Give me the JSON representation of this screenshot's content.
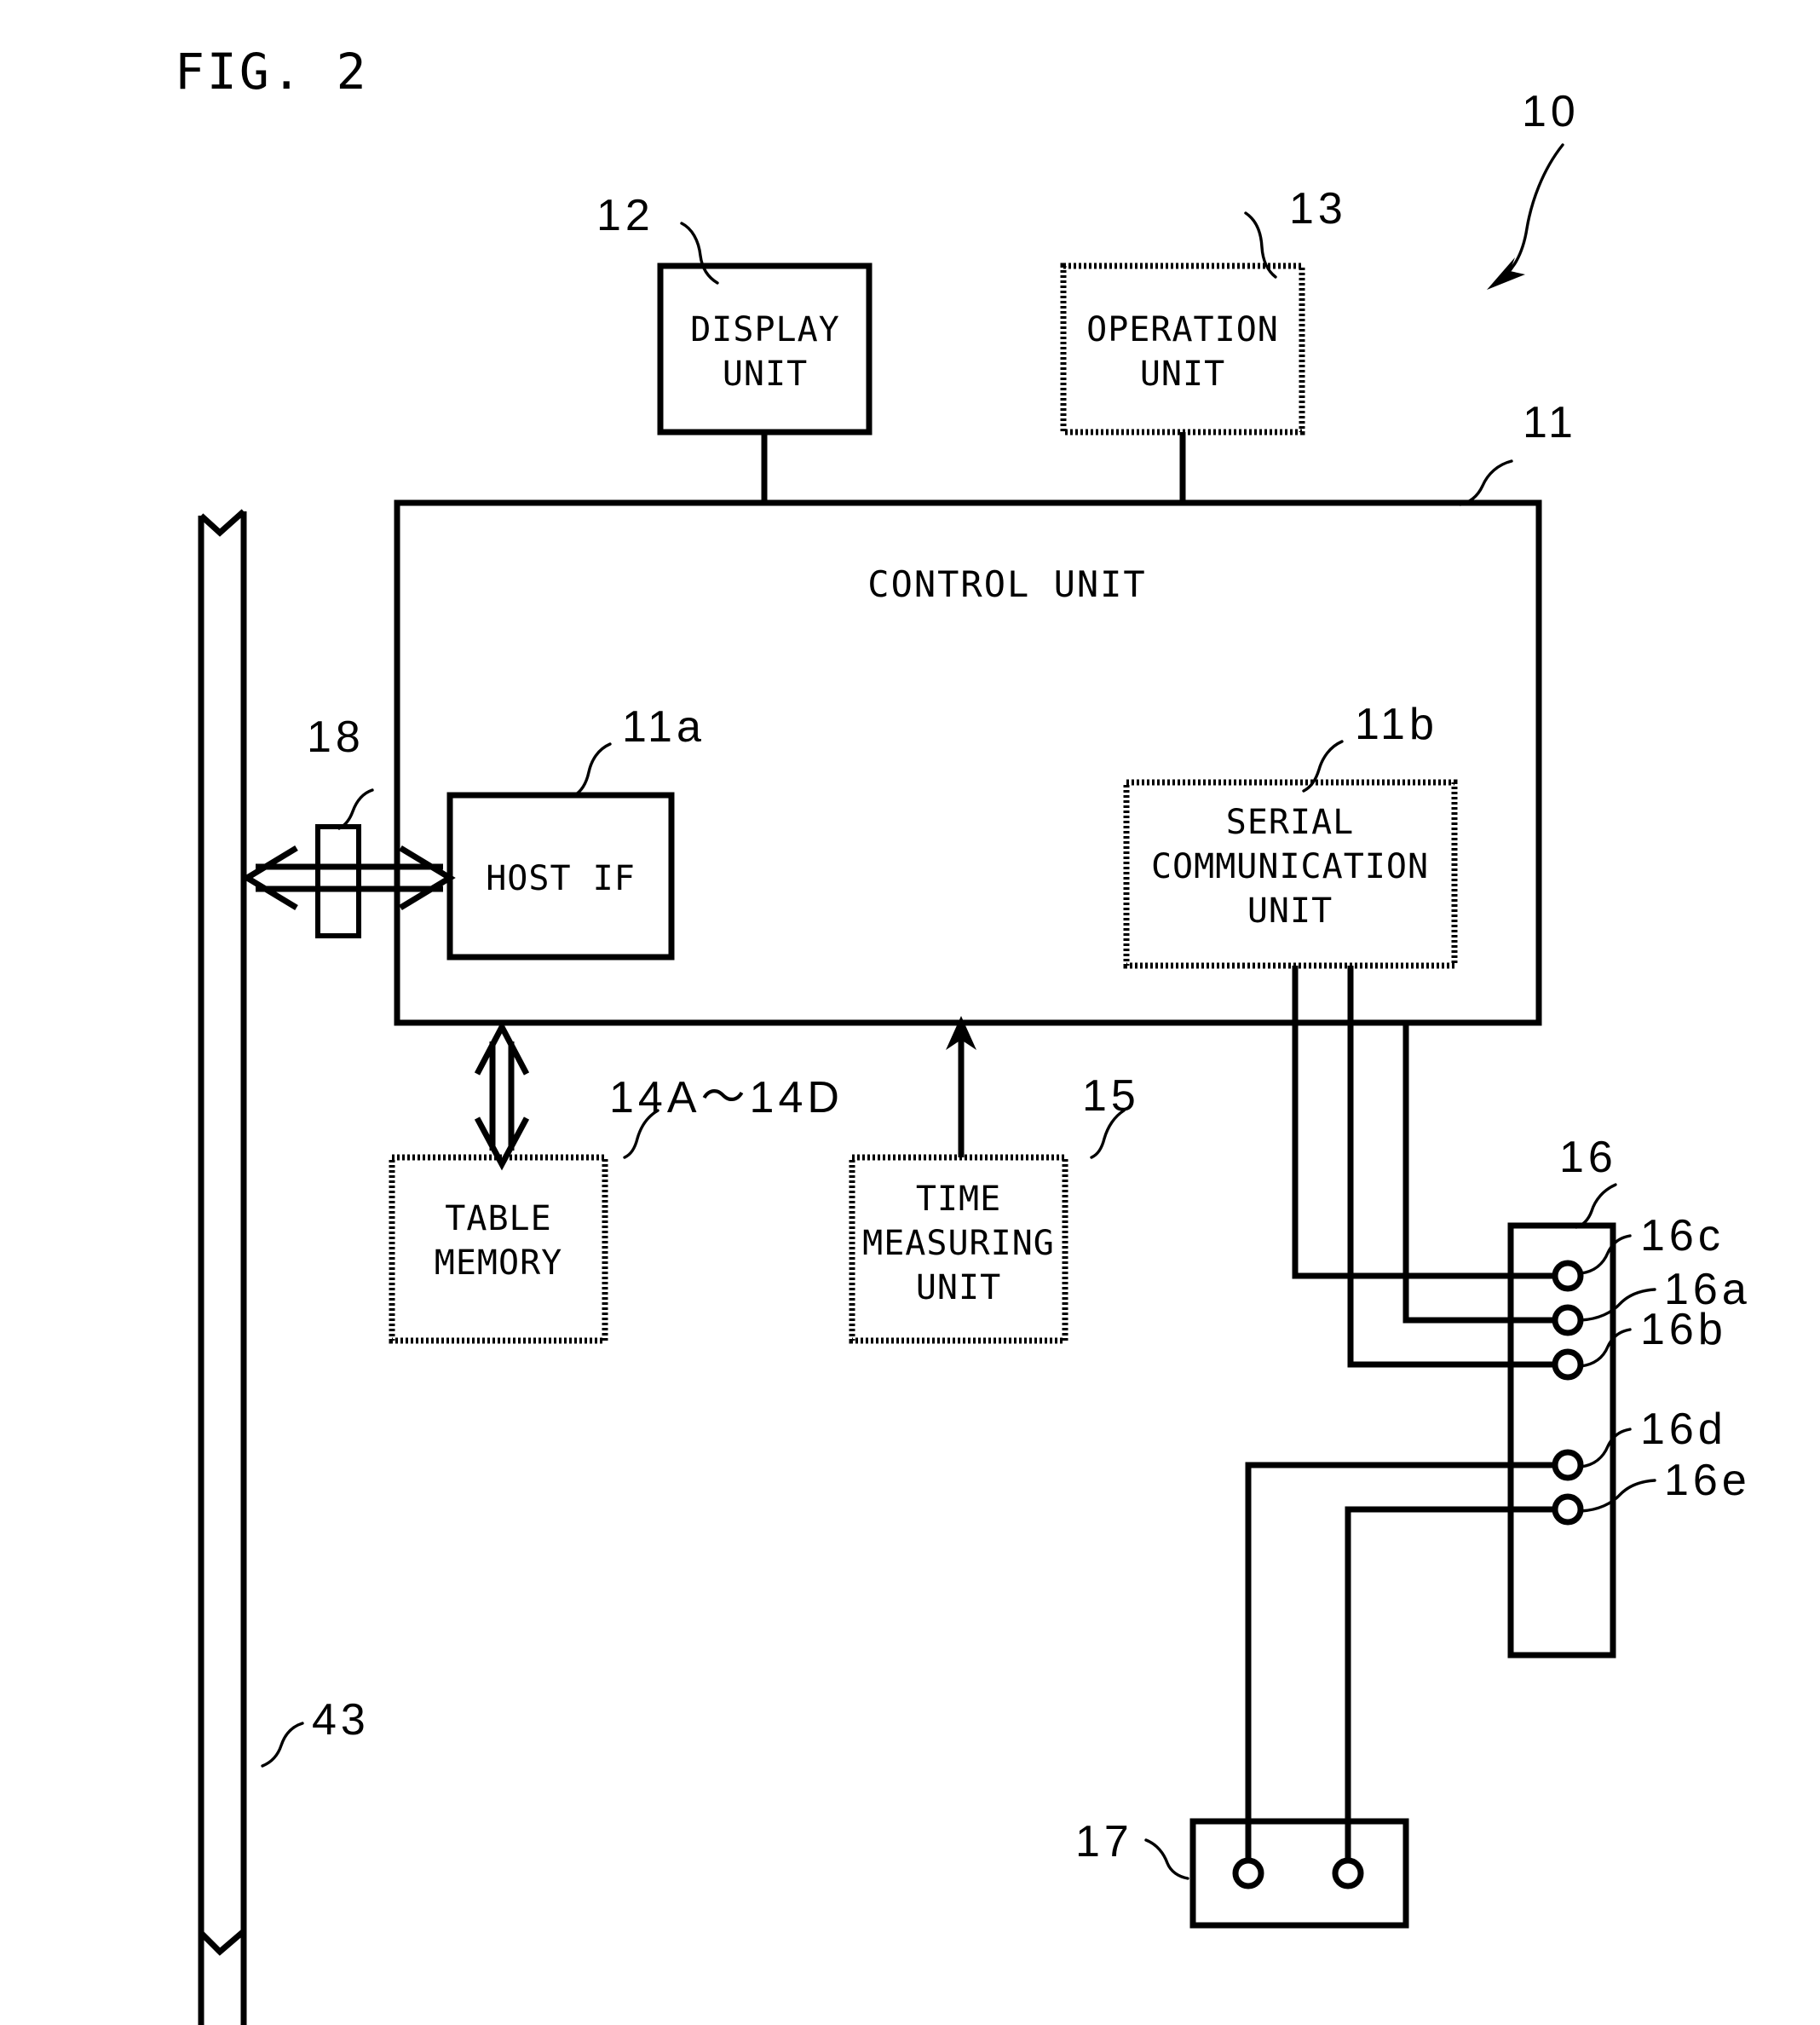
{
  "figure": {
    "title": "FIG. 2",
    "system_ref": "10"
  },
  "blocks": {
    "display_unit": {
      "label_line1": "DISPLAY",
      "label_line2": "UNIT",
      "ref": "12",
      "border": "solid"
    },
    "operation_unit": {
      "label_line1": "OPERATION",
      "label_line2": "UNIT",
      "ref": "13",
      "border": "dotted"
    },
    "control_unit": {
      "label": "CONTROL UNIT",
      "ref": "11",
      "border": "solid"
    },
    "host_if": {
      "label": "HOST IF",
      "ref": "11a",
      "border": "solid"
    },
    "serial_comm_unit": {
      "label_line1": "SERIAL",
      "label_line2": "COMMUNICATION",
      "label_line3": "UNIT",
      "ref": "11b",
      "border": "dotted"
    },
    "table_memory": {
      "label_line1": "TABLE",
      "label_line2": "MEMORY",
      "ref": "14A〜14D",
      "border": "dotted"
    },
    "time_measuring_unit": {
      "label_line1": "TIME",
      "label_line2": "MEASURING",
      "label_line3": "UNIT",
      "ref": "15",
      "border": "dotted"
    },
    "connector_block": {
      "ref": "16",
      "border": "solid"
    },
    "external_device": {
      "ref": "17",
      "border": "solid"
    },
    "interface_connector": {
      "ref": "18",
      "border": "solid"
    },
    "host_bus": {
      "ref": "43",
      "border": "solid"
    }
  },
  "terminals": {
    "connector_16": [
      {
        "ref": "16c"
      },
      {
        "ref": "16a"
      },
      {
        "ref": "16b"
      },
      {
        "ref": "16d"
      },
      {
        "ref": "16e"
      }
    ],
    "device_17": [
      {
        "ref": "17-terminal-left"
      },
      {
        "ref": "17-terminal-right"
      }
    ]
  },
  "colors": {
    "line": "#000000",
    "background": "#ffffff"
  }
}
